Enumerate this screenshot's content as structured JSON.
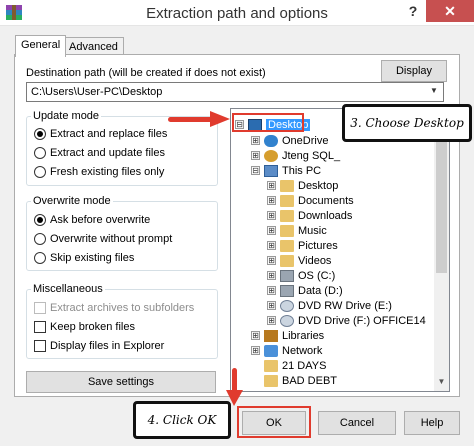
{
  "window": {
    "title": "Extraction path and options",
    "help_label": "?",
    "close_label": "✕"
  },
  "tabs": [
    {
      "label": "General",
      "active": true
    },
    {
      "label": "Advanced",
      "active": false
    }
  ],
  "destination": {
    "label": "Destination path (will be created if does not exist)",
    "value": "C:\\Users\\User-PC\\Desktop",
    "display_button": "Display"
  },
  "update_mode": {
    "title": "Update mode",
    "options": [
      {
        "label": "Extract and replace files",
        "selected": true
      },
      {
        "label": "Extract and update files",
        "selected": false
      },
      {
        "label": "Fresh existing files only",
        "selected": false
      }
    ]
  },
  "overwrite_mode": {
    "title": "Overwrite mode",
    "options": [
      {
        "label": "Ask before overwrite",
        "selected": true
      },
      {
        "label": "Overwrite without prompt",
        "selected": false
      },
      {
        "label": "Skip existing files",
        "selected": false
      }
    ]
  },
  "miscellaneous": {
    "title": "Miscellaneous",
    "options": [
      {
        "label": "Extract archives to subfolders",
        "checked": false,
        "disabled": true
      },
      {
        "label": "Keep broken files",
        "checked": false,
        "disabled": false
      },
      {
        "label": "Display files in Explorer",
        "checked": false,
        "disabled": false
      }
    ]
  },
  "save_settings_button": "Save settings",
  "tree": {
    "items": [
      {
        "label": "Desktop",
        "icon": "monitor-icon",
        "expander": "⊟",
        "selected": true
      },
      {
        "label": "OneDrive",
        "icon": "cloud-icon",
        "expander": "⊞",
        "selected": false
      },
      {
        "label": "Jteng SQL_",
        "icon": "user-folder-icon",
        "expander": "⊞",
        "selected": false
      },
      {
        "label": "This PC",
        "icon": "computer-icon",
        "expander": "⊟",
        "selected": false
      },
      {
        "label": "Desktop",
        "icon": "folder-icon",
        "expander": "⊞",
        "selected": false
      },
      {
        "label": "Documents",
        "icon": "folder-icon",
        "expander": "⊞",
        "selected": false
      },
      {
        "label": "Downloads",
        "icon": "folder-icon",
        "expander": "⊞",
        "selected": false
      },
      {
        "label": "Music",
        "icon": "folder-icon",
        "expander": "⊞",
        "selected": false
      },
      {
        "label": "Pictures",
        "icon": "folder-icon",
        "expander": "⊞",
        "selected": false
      },
      {
        "label": "Videos",
        "icon": "folder-icon",
        "expander": "⊞",
        "selected": false
      },
      {
        "label": "OS (C:)",
        "icon": "drive-icon",
        "expander": "⊞",
        "selected": false
      },
      {
        "label": "Data (D:)",
        "icon": "drive-icon",
        "expander": "⊞",
        "selected": false
      },
      {
        "label": "DVD RW Drive (E:)",
        "icon": "disc-icon",
        "expander": "⊞",
        "selected": false
      },
      {
        "label": "DVD Drive (F:) OFFICE14",
        "icon": "disc-icon",
        "expander": "⊞",
        "selected": false
      },
      {
        "label": "Libraries",
        "icon": "library-icon",
        "expander": "⊞",
        "selected": false
      },
      {
        "label": "Network",
        "icon": "network-icon",
        "expander": "⊞",
        "selected": false
      },
      {
        "label": "21 DAYS",
        "icon": "folder-icon",
        "expander": "",
        "selected": false
      },
      {
        "label": "BAD DEBT",
        "icon": "folder-icon",
        "expander": "",
        "selected": false
      }
    ]
  },
  "buttons": {
    "ok": "OK",
    "cancel": "Cancel",
    "help": "Help"
  },
  "annotations": {
    "choose_desktop": "3. Choose Desktop",
    "click_ok": "4. Click OK",
    "highlight_color": "#e03b2e"
  }
}
